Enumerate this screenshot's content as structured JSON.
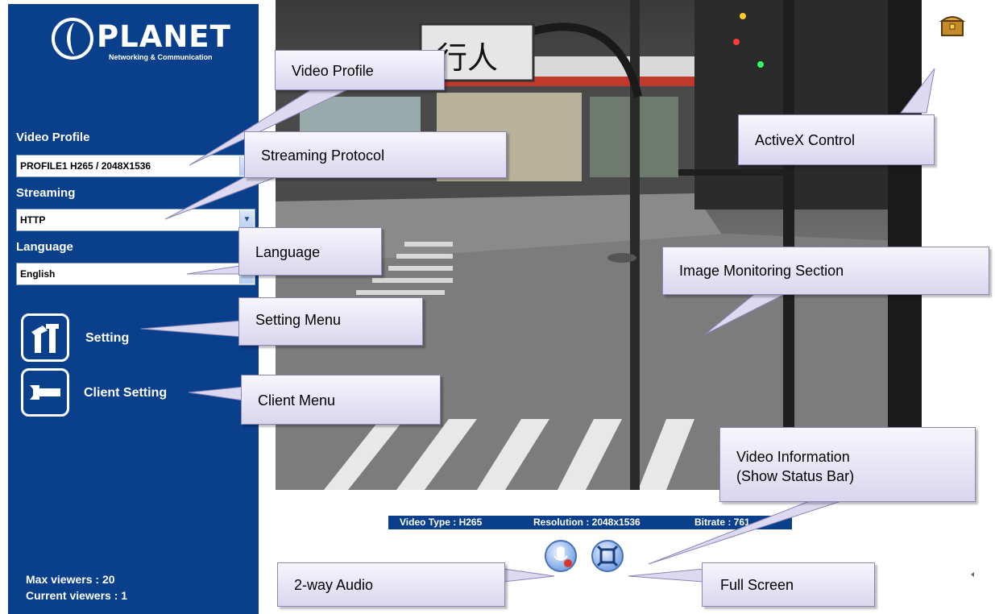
{
  "sidebar": {
    "logo": {
      "brand": "PLANET",
      "tagline": "Networking & Communication"
    },
    "video_profile": {
      "label": "Video Profile",
      "value": "PROFILE1 H265 / 2048X1536"
    },
    "streaming": {
      "label": "Streaming",
      "value": "HTTP"
    },
    "language": {
      "label": "Language",
      "value": "English"
    },
    "menu": [
      {
        "label": "Setting",
        "icon": "tools-icon"
      },
      {
        "label": "Client Setting",
        "icon": "wrench-icon"
      }
    ],
    "max_viewers": "Max viewers : 20",
    "current_viewers": "Current viewers : 1"
  },
  "camera": {
    "sign_text": "行人"
  },
  "status_bar": {
    "video_type": "Video Type : H265",
    "resolution": "Resolution : 2048x1536",
    "bitrate": "Bitrate : 761"
  },
  "controls": {
    "audio_icon": "microphone-icon",
    "fullscreen_icon": "fullscreen-icon",
    "activex_icon": "treasure-chest-icon"
  },
  "callouts": {
    "video_profile": "Video Profile",
    "streaming_protocol": "Streaming Protocol",
    "language": "Language",
    "setting_menu": "Setting Menu",
    "client_menu": "Client Menu",
    "activex_control": "ActiveX Control",
    "image_monitoring": "Image Monitoring Section",
    "video_info_line1": "Video Information",
    "video_info_line2": "(Show Status Bar)",
    "two_way_audio": "2-way Audio",
    "full_screen": "Full Screen"
  },
  "colors": {
    "sidebar": "#0a3f8c",
    "callout_border": "#8a86b8"
  }
}
